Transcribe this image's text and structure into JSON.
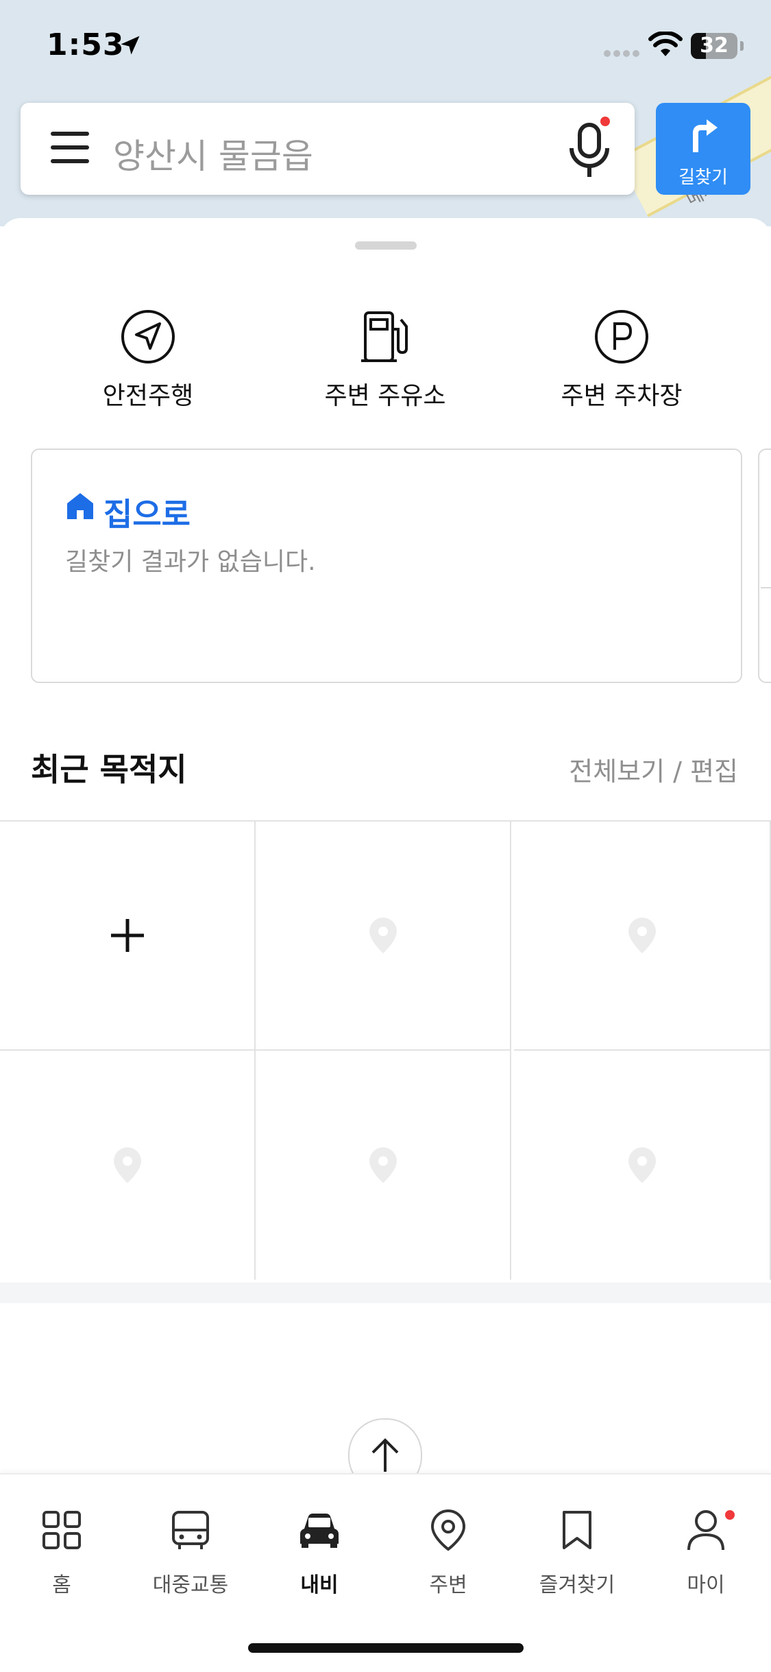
{
  "status_bar": {
    "time": "1:53",
    "battery": "32"
  },
  "map": {
    "road_label": "메가"
  },
  "search": {
    "placeholder": "양산시 물금읍",
    "route_button_label": "길찾기"
  },
  "quick_actions": [
    {
      "label": "안전주행",
      "icon": "navigation-icon"
    },
    {
      "label": "주변 주유소",
      "icon": "gas-station-icon"
    },
    {
      "label": "주변 주차장",
      "icon": "parking-icon"
    }
  ],
  "home_card": {
    "title": "집으로",
    "subtitle": "길찾기 결과가 없습니다."
  },
  "recent": {
    "title": "최근 목적지",
    "links": "전체보기 / 편집"
  },
  "tabs": [
    {
      "label": "홈",
      "icon": "grid-icon",
      "active": false
    },
    {
      "label": "대중교통",
      "icon": "bus-icon",
      "active": false
    },
    {
      "label": "내비",
      "icon": "car-icon",
      "active": true
    },
    {
      "label": "주변",
      "icon": "location-pin-icon",
      "active": false
    },
    {
      "label": "즐겨찾기",
      "icon": "bookmark-icon",
      "active": false
    },
    {
      "label": "마이",
      "icon": "person-icon",
      "active": false
    }
  ],
  "colors": {
    "accent": "#2f8df5",
    "home_title": "#1d6de6",
    "notification": "#f0393a"
  }
}
